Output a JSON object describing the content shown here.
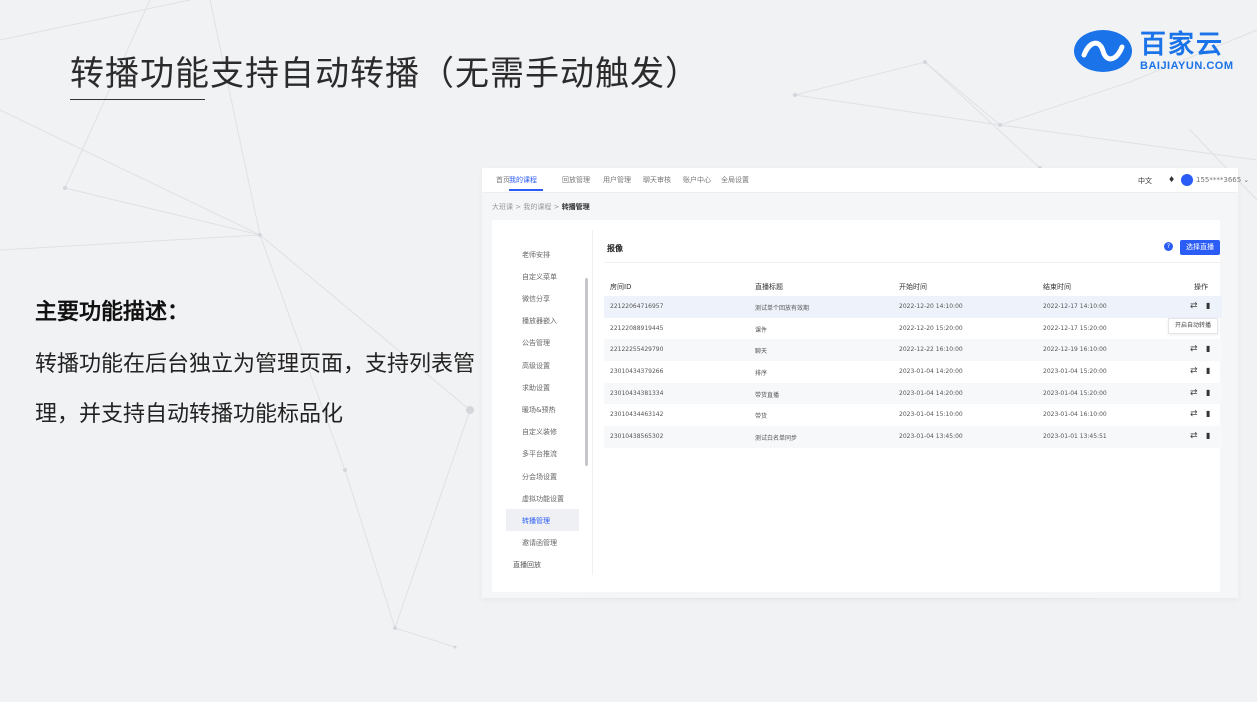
{
  "slide": {
    "title": "转播功能支持自动转播（无需手动触发）",
    "logo_cn": "百家云",
    "logo_en": "BAIJIAYUN.COM",
    "desc_heading": "主要功能描述：",
    "desc_body": "转播功能在后台独立为管理页面，支持列表管理，并支持自动转播功能标品化"
  },
  "app": {
    "nav": {
      "items": [
        "首页",
        "我的课程",
        "回放管理",
        "用户管理",
        "聊天审核",
        "账户中心",
        "全局设置"
      ],
      "active_index": 1,
      "lang": "中文",
      "user": "155****3665 ⌄"
    },
    "breadcrumb": {
      "root": "大班课",
      "sep": ">",
      "parent": "我的课程",
      "current": "转播管理"
    },
    "sidebar": {
      "items": [
        "老师安排",
        "自定义菜单",
        "微信分享",
        "播放器嵌入",
        "公告管理",
        "高级设置",
        "求助设置",
        "暖场&预热",
        "自定义装修",
        "多平台推流",
        "分会场设置",
        "虚拟功能设置",
        "转播管理",
        "邀请函管理"
      ],
      "active_index": 12,
      "bottom": "直播回放"
    },
    "main": {
      "title": "报像",
      "select_button": "选择直播",
      "columns": [
        "房间ID",
        "直播标题",
        "开始时间",
        "结束时间",
        "操作"
      ],
      "rows": [
        [
          "22122064716957",
          "测试单个回放有效期",
          "2022-12-20 14:10:00",
          "2022-12-17 14:10:00"
        ],
        [
          "22122088919445",
          "课件",
          "2022-12-20 15:20:00",
          "2022-12-17 15:20:00"
        ],
        [
          "22122255429790",
          "聊天",
          "2022-12-22 16:10:00",
          "2022-12-19 16:10:00"
        ],
        [
          "23010434379266",
          "排序",
          "2023-01-04 14:20:00",
          "2023-01-04 15:20:00"
        ],
        [
          "23010434381334",
          "带货直播",
          "2023-01-04 14:20:00",
          "2023-01-04 15:20:00"
        ],
        [
          "23010434463142",
          "带货",
          "2023-01-04 15:10:00",
          "2023-01-04 16:10:00"
        ],
        [
          "23010438565302",
          "测试白名单同步",
          "2023-01-04 13:45:00",
          "2023-01-01 13:45:51"
        ]
      ],
      "tooltip": "开启自动转播"
    }
  }
}
